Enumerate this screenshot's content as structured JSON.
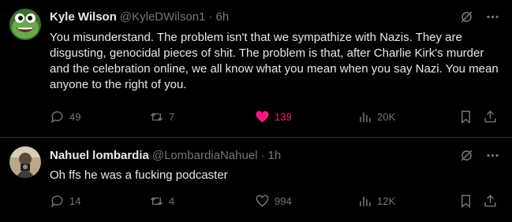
{
  "tweets": [
    {
      "name": "Kyle Wilson",
      "handle": "@KyleDWilson1",
      "sep": "·",
      "time": "6h",
      "text": "You misunderstand. The problem isn't that we sympathize with Nazis. They are disgusting, genocidal pieces of shit. The problem is that, after Charlie Kirk's murder and the celebration online, we all know what you mean when you say Nazi. You mean anyone to the right of you.",
      "replies": "49",
      "reposts": "7",
      "likes": "139",
      "views": "20K",
      "liked": true
    },
    {
      "name": "Nahuel lombardia",
      "handle": "@LombardiaNahuel",
      "sep": "·",
      "time": "1h",
      "text": "Oh ffs he was a fucking podcaster",
      "replies": "14",
      "reposts": "4",
      "likes": "994",
      "views": "12K",
      "liked": false
    }
  ],
  "colors": {
    "background": "#000000",
    "text": "#e7e9ea",
    "muted": "#71767b",
    "like": "#f91880",
    "divider": "#2f3336"
  },
  "icons": [
    "grok-icon",
    "more-icon",
    "reply-icon",
    "repost-icon",
    "like-icon",
    "views-icon",
    "bookmark-icon",
    "share-icon"
  ]
}
